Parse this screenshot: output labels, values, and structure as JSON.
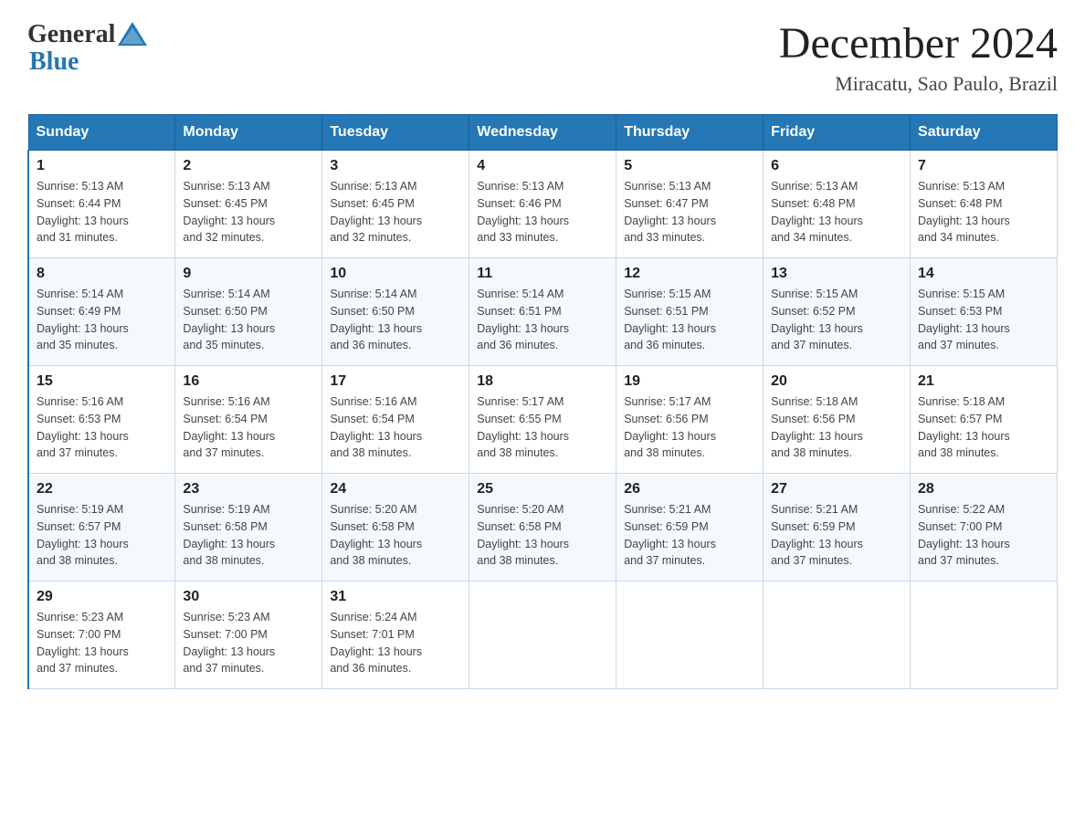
{
  "logo": {
    "text_general": "General",
    "text_blue": "Blue"
  },
  "title": "December 2024",
  "subtitle": "Miracatu, Sao Paulo, Brazil",
  "days_of_week": [
    "Sunday",
    "Monday",
    "Tuesday",
    "Wednesday",
    "Thursday",
    "Friday",
    "Saturday"
  ],
  "weeks": [
    [
      {
        "day": "1",
        "sunrise": "5:13 AM",
        "sunset": "6:44 PM",
        "daylight": "13 hours and 31 minutes."
      },
      {
        "day": "2",
        "sunrise": "5:13 AM",
        "sunset": "6:45 PM",
        "daylight": "13 hours and 32 minutes."
      },
      {
        "day": "3",
        "sunrise": "5:13 AM",
        "sunset": "6:45 PM",
        "daylight": "13 hours and 32 minutes."
      },
      {
        "day": "4",
        "sunrise": "5:13 AM",
        "sunset": "6:46 PM",
        "daylight": "13 hours and 33 minutes."
      },
      {
        "day": "5",
        "sunrise": "5:13 AM",
        "sunset": "6:47 PM",
        "daylight": "13 hours and 33 minutes."
      },
      {
        "day": "6",
        "sunrise": "5:13 AM",
        "sunset": "6:48 PM",
        "daylight": "13 hours and 34 minutes."
      },
      {
        "day": "7",
        "sunrise": "5:13 AM",
        "sunset": "6:48 PM",
        "daylight": "13 hours and 34 minutes."
      }
    ],
    [
      {
        "day": "8",
        "sunrise": "5:14 AM",
        "sunset": "6:49 PM",
        "daylight": "13 hours and 35 minutes."
      },
      {
        "day": "9",
        "sunrise": "5:14 AM",
        "sunset": "6:50 PM",
        "daylight": "13 hours and 35 minutes."
      },
      {
        "day": "10",
        "sunrise": "5:14 AM",
        "sunset": "6:50 PM",
        "daylight": "13 hours and 36 minutes."
      },
      {
        "day": "11",
        "sunrise": "5:14 AM",
        "sunset": "6:51 PM",
        "daylight": "13 hours and 36 minutes."
      },
      {
        "day": "12",
        "sunrise": "5:15 AM",
        "sunset": "6:51 PM",
        "daylight": "13 hours and 36 minutes."
      },
      {
        "day": "13",
        "sunrise": "5:15 AM",
        "sunset": "6:52 PM",
        "daylight": "13 hours and 37 minutes."
      },
      {
        "day": "14",
        "sunrise": "5:15 AM",
        "sunset": "6:53 PM",
        "daylight": "13 hours and 37 minutes."
      }
    ],
    [
      {
        "day": "15",
        "sunrise": "5:16 AM",
        "sunset": "6:53 PM",
        "daylight": "13 hours and 37 minutes."
      },
      {
        "day": "16",
        "sunrise": "5:16 AM",
        "sunset": "6:54 PM",
        "daylight": "13 hours and 37 minutes."
      },
      {
        "day": "17",
        "sunrise": "5:16 AM",
        "sunset": "6:54 PM",
        "daylight": "13 hours and 38 minutes."
      },
      {
        "day": "18",
        "sunrise": "5:17 AM",
        "sunset": "6:55 PM",
        "daylight": "13 hours and 38 minutes."
      },
      {
        "day": "19",
        "sunrise": "5:17 AM",
        "sunset": "6:56 PM",
        "daylight": "13 hours and 38 minutes."
      },
      {
        "day": "20",
        "sunrise": "5:18 AM",
        "sunset": "6:56 PM",
        "daylight": "13 hours and 38 minutes."
      },
      {
        "day": "21",
        "sunrise": "5:18 AM",
        "sunset": "6:57 PM",
        "daylight": "13 hours and 38 minutes."
      }
    ],
    [
      {
        "day": "22",
        "sunrise": "5:19 AM",
        "sunset": "6:57 PM",
        "daylight": "13 hours and 38 minutes."
      },
      {
        "day": "23",
        "sunrise": "5:19 AM",
        "sunset": "6:58 PM",
        "daylight": "13 hours and 38 minutes."
      },
      {
        "day": "24",
        "sunrise": "5:20 AM",
        "sunset": "6:58 PM",
        "daylight": "13 hours and 38 minutes."
      },
      {
        "day": "25",
        "sunrise": "5:20 AM",
        "sunset": "6:58 PM",
        "daylight": "13 hours and 38 minutes."
      },
      {
        "day": "26",
        "sunrise": "5:21 AM",
        "sunset": "6:59 PM",
        "daylight": "13 hours and 37 minutes."
      },
      {
        "day": "27",
        "sunrise": "5:21 AM",
        "sunset": "6:59 PM",
        "daylight": "13 hours and 37 minutes."
      },
      {
        "day": "28",
        "sunrise": "5:22 AM",
        "sunset": "7:00 PM",
        "daylight": "13 hours and 37 minutes."
      }
    ],
    [
      {
        "day": "29",
        "sunrise": "5:23 AM",
        "sunset": "7:00 PM",
        "daylight": "13 hours and 37 minutes."
      },
      {
        "day": "30",
        "sunrise": "5:23 AM",
        "sunset": "7:00 PM",
        "daylight": "13 hours and 37 minutes."
      },
      {
        "day": "31",
        "sunrise": "5:24 AM",
        "sunset": "7:01 PM",
        "daylight": "13 hours and 36 minutes."
      },
      null,
      null,
      null,
      null
    ]
  ],
  "labels": {
    "sunrise": "Sunrise:",
    "sunset": "Sunset:",
    "daylight": "Daylight:"
  }
}
